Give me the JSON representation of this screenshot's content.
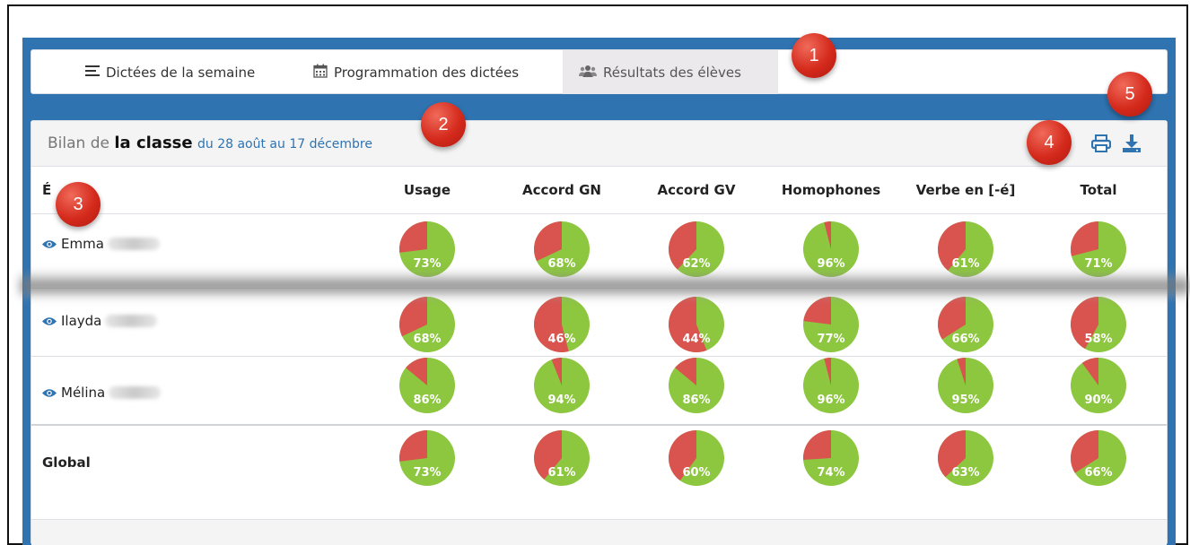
{
  "nav": {
    "tabs": [
      {
        "label": "Dictées de la semaine",
        "icon": "list-icon"
      },
      {
        "label": "Programmation des dictées",
        "icon": "calendar-icon"
      },
      {
        "label": "Résultats des élèves",
        "icon": "users-icon"
      }
    ]
  },
  "card": {
    "title_prefix": "Bilan de",
    "title_bold": "la classe",
    "title_dates": "du 28 août au 17 décembre"
  },
  "table": {
    "first_header": "É",
    "headers": [
      "Usage",
      "Accord GN",
      "Accord GV",
      "Homophones",
      "Verbe en [-é]",
      "Total"
    ],
    "rows": [
      {
        "name": "Emma",
        "values": [
          73,
          68,
          62,
          96,
          61,
          71
        ]
      },
      {
        "name": "Ilayda",
        "values": [
          68,
          46,
          44,
          77,
          66,
          58
        ]
      },
      {
        "name": "Mélina",
        "values": [
          86,
          94,
          86,
          96,
          95,
          90
        ]
      }
    ],
    "global": {
      "label": "Global",
      "values": [
        73,
        61,
        60,
        74,
        63,
        66
      ]
    }
  },
  "markers": [
    "1",
    "2",
    "3",
    "4",
    "5"
  ],
  "colors": {
    "success": "#8dc63f",
    "error": "#d9534f",
    "panel_blue": "#2f73b0",
    "marker_red": "#d42a1c"
  }
}
